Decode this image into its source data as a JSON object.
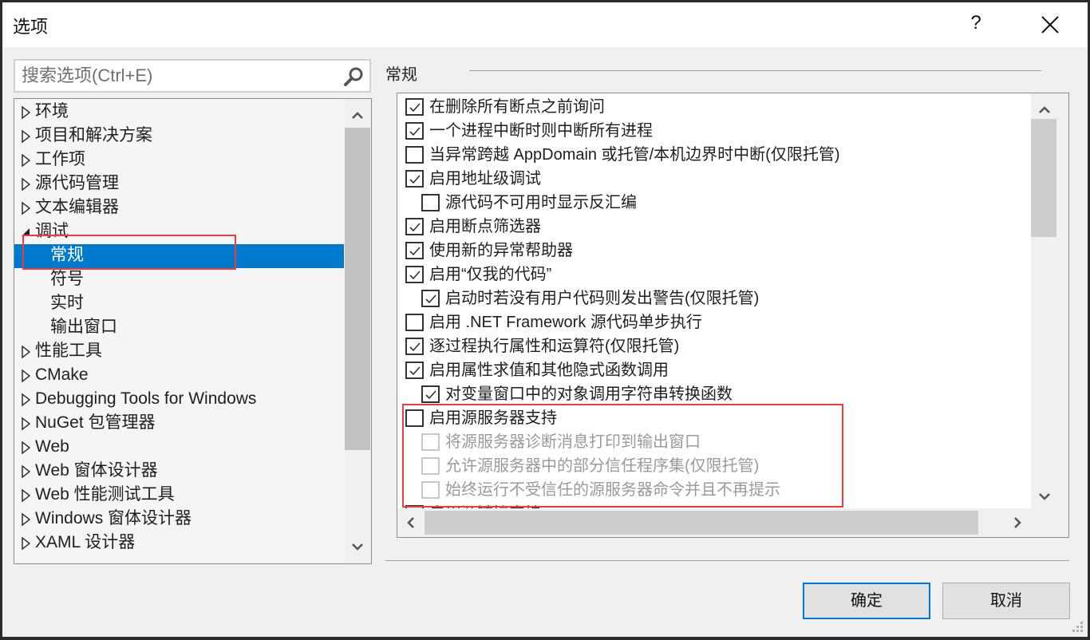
{
  "window": {
    "title": "选项",
    "help_label": "?",
    "close_icon": "close-icon"
  },
  "search": {
    "placeholder": "搜索选项(Ctrl+E)",
    "value": "",
    "icon": "search-icon"
  },
  "tree": {
    "items": [
      {
        "label": "环境",
        "level": 0,
        "state": "collapsed"
      },
      {
        "label": "项目和解决方案",
        "level": 0,
        "state": "collapsed"
      },
      {
        "label": "工作项",
        "level": 0,
        "state": "collapsed"
      },
      {
        "label": "源代码管理",
        "level": 0,
        "state": "collapsed"
      },
      {
        "label": "文本编辑器",
        "level": 0,
        "state": "collapsed"
      },
      {
        "label": "调试",
        "level": 0,
        "state": "expanded"
      },
      {
        "label": "常规",
        "level": 1,
        "state": "leaf",
        "selected": true
      },
      {
        "label": "符号",
        "level": 1,
        "state": "leaf"
      },
      {
        "label": "实时",
        "level": 1,
        "state": "leaf"
      },
      {
        "label": "输出窗口",
        "level": 1,
        "state": "leaf"
      },
      {
        "label": "性能工具",
        "level": 0,
        "state": "collapsed"
      },
      {
        "label": "CMake",
        "level": 0,
        "state": "collapsed"
      },
      {
        "label": "Debugging Tools for Windows",
        "level": 0,
        "state": "collapsed"
      },
      {
        "label": "NuGet 包管理器",
        "level": 0,
        "state": "collapsed"
      },
      {
        "label": "Web",
        "level": 0,
        "state": "collapsed"
      },
      {
        "label": "Web 窗体设计器",
        "level": 0,
        "state": "collapsed"
      },
      {
        "label": "Web 性能测试工具",
        "level": 0,
        "state": "collapsed"
      },
      {
        "label": "Windows 窗体设计器",
        "level": 0,
        "state": "collapsed"
      },
      {
        "label": "XAML 设计器",
        "level": 0,
        "state": "collapsed"
      }
    ]
  },
  "section": {
    "title": "常规"
  },
  "options": [
    {
      "label": "在删除所有断点之前询问",
      "checked": true,
      "indent": 0,
      "enabled": true
    },
    {
      "label": "一个进程中断时则中断所有进程",
      "checked": true,
      "indent": 0,
      "enabled": true
    },
    {
      "label": "当异常跨越 AppDomain 或托管/本机边界时中断(仅限托管)",
      "checked": false,
      "indent": 0,
      "enabled": true
    },
    {
      "label": "启用地址级调试",
      "checked": true,
      "indent": 0,
      "enabled": true
    },
    {
      "label": "源代码不可用时显示反汇编",
      "checked": false,
      "indent": 1,
      "enabled": true
    },
    {
      "label": "启用断点筛选器",
      "checked": true,
      "indent": 0,
      "enabled": true
    },
    {
      "label": "使用新的异常帮助器",
      "checked": true,
      "indent": 0,
      "enabled": true
    },
    {
      "label": "启用“仅我的代码”",
      "checked": true,
      "indent": 0,
      "enabled": true
    },
    {
      "label": "启动时若没有用户代码则发出警告(仅限托管)",
      "checked": true,
      "indent": 1,
      "enabled": true
    },
    {
      "label": "启用 .NET Framework 源代码单步执行",
      "checked": false,
      "indent": 0,
      "enabled": true
    },
    {
      "label": "逐过程执行属性和运算符(仅限托管)",
      "checked": true,
      "indent": 0,
      "enabled": true
    },
    {
      "label": "启用属性求值和其他隐式函数调用",
      "checked": true,
      "indent": 0,
      "enabled": true
    },
    {
      "label": "对变量窗口中的对象调用字符串转换函数",
      "checked": true,
      "indent": 1,
      "enabled": true
    },
    {
      "label": "启用源服务器支持",
      "checked": false,
      "indent": 0,
      "enabled": true
    },
    {
      "label": "将源服务器诊断消息打印到输出窗口",
      "checked": false,
      "indent": 1,
      "enabled": false
    },
    {
      "label": "允许源服务器中的部分信任程序集(仅限托管)",
      "checked": false,
      "indent": 1,
      "enabled": false
    },
    {
      "label": "始终运行不受信任的源服务器命令并且不再提示",
      "checked": false,
      "indent": 1,
      "enabled": false
    },
    {
      "label": "启用源链接支持",
      "checked": false,
      "indent": 0,
      "enabled": true
    }
  ],
  "scroll": {
    "tree_position": 0.0,
    "options_vertical_position": 0.0,
    "options_horizontal_position": 0.0
  },
  "buttons": {
    "ok": "确定",
    "cancel": "取消"
  },
  "colors": {
    "selection": "#007acc",
    "highlight_box": "#ef3b3b",
    "primary_button_border": "#0078d7"
  }
}
